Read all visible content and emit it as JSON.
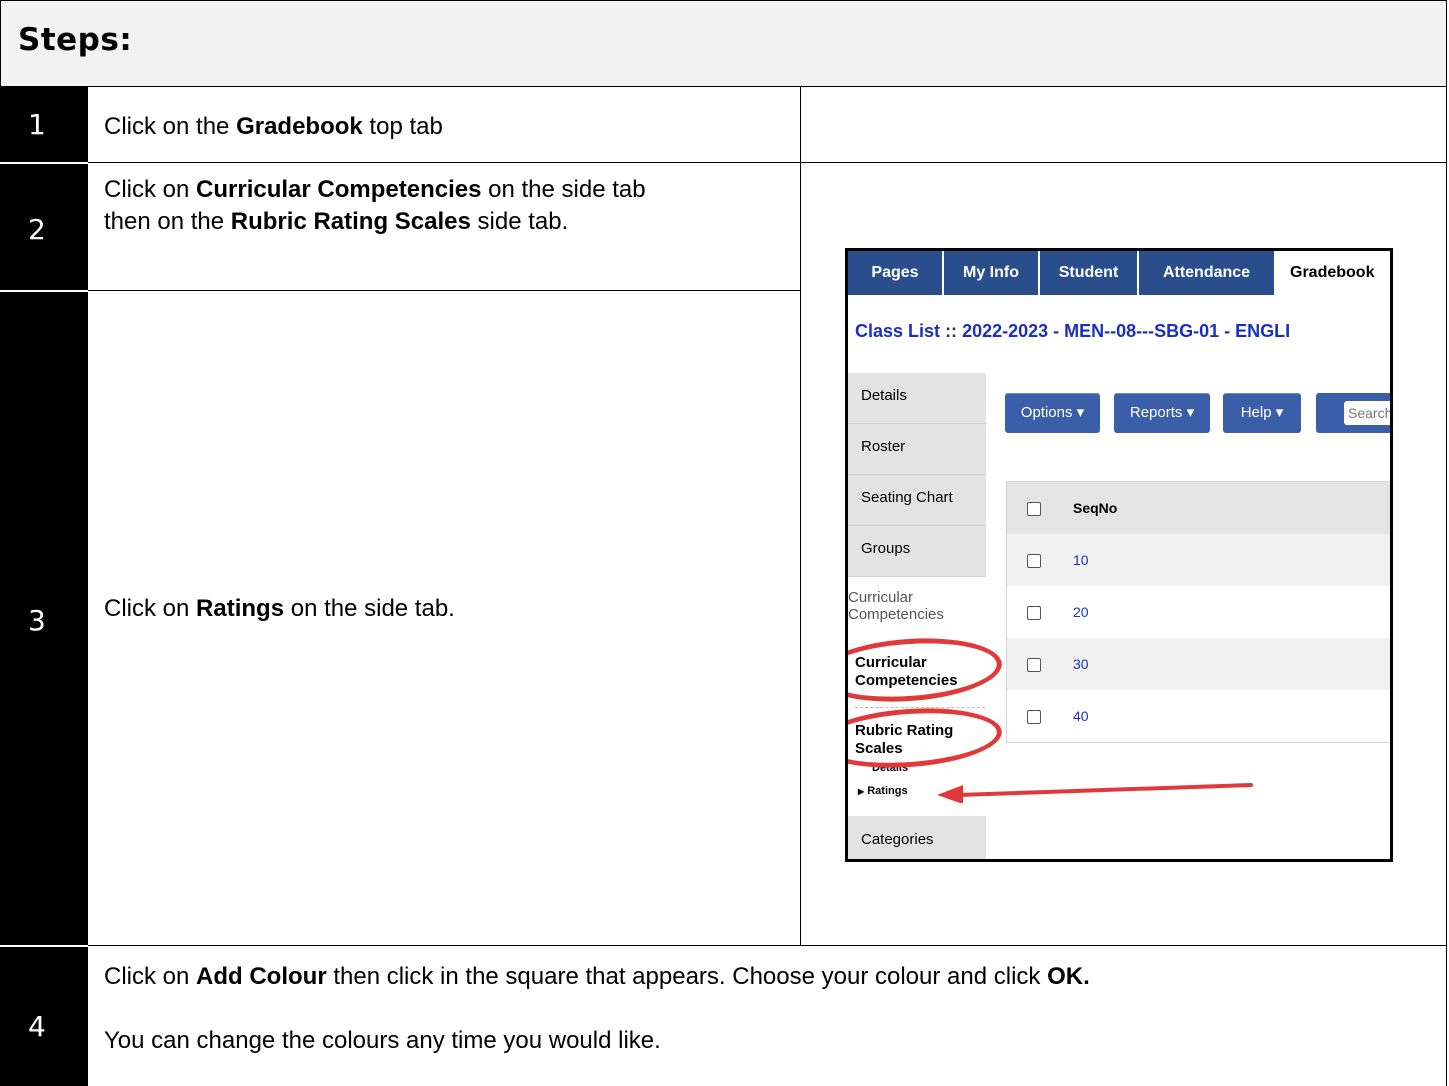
{
  "document": {
    "title": "Steps:",
    "steps": [
      {
        "number": "1",
        "lines": [
          [
            "Click on the ",
            "Gradebook",
            " top tab"
          ]
        ]
      },
      {
        "number": "2",
        "lines": [
          [
            "Click on ",
            "Curricular Competencies",
            " on the side tab"
          ],
          [
            "then on the ",
            "Rubric Rating Scales",
            " side tab."
          ]
        ]
      },
      {
        "number": "3",
        "lines": [
          [
            "Click on ",
            "Ratings",
            " on the side tab."
          ]
        ]
      },
      {
        "number": "4",
        "lines": [
          [
            "Click on ",
            "Add Colour",
            " then click in the square that appears. Choose your colour and click ",
            "OK."
          ]
        ],
        "note": "You can change the colours any time you would like."
      }
    ]
  },
  "screenshot": {
    "nav_tabs": [
      "Pages",
      "My Info",
      "Student",
      "Attendance",
      "Gradebook"
    ],
    "active_tab": "Gradebook",
    "class_list": {
      "label": "Class List",
      "separator": "::",
      "value": "2022-2023 - MEN--08---SBG-01 - ENGLI"
    },
    "side_tabs": [
      "Details",
      "Roster",
      "Seating Chart",
      "Groups"
    ],
    "side_sub_group": "Curricular Competencies",
    "side_selected_1": "Curricular Competencies",
    "side_selected_2": "Rubric Rating Scales",
    "side_sub_details": "Details",
    "side_sub_ratings": "Ratings",
    "side_bottom": "Categories",
    "buttons": {
      "options": "Options",
      "reports": "Reports",
      "help": "Help",
      "search_placeholder": "Search"
    },
    "grid": {
      "column": "SeqNo",
      "rows": [
        "10",
        "20",
        "30",
        "40"
      ]
    },
    "colors": {
      "nav": "#2a4d8b",
      "button": "#3b5ea8",
      "link": "#1a2fbf",
      "highlight": "#e0393a"
    }
  }
}
